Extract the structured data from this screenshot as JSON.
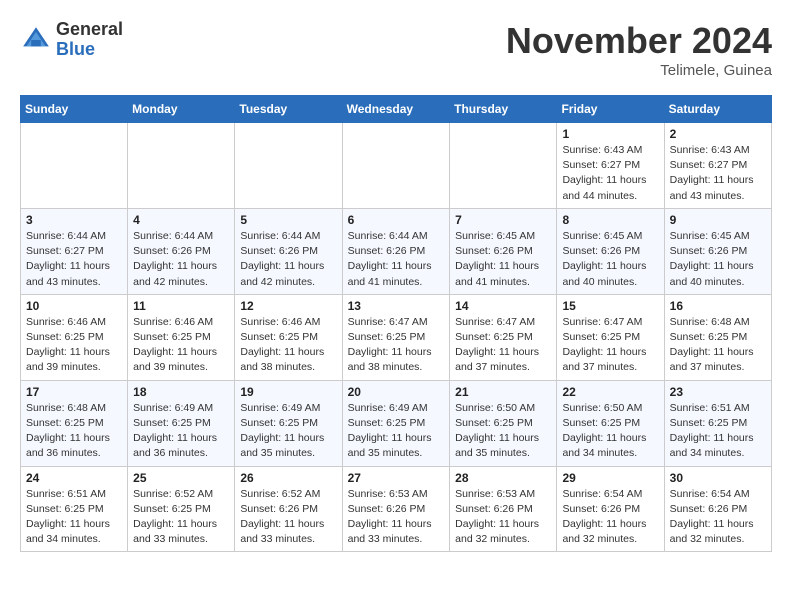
{
  "logo": {
    "text_general": "General",
    "text_blue": "Blue"
  },
  "title": "November 2024",
  "location": "Telimele, Guinea",
  "days_of_week": [
    "Sunday",
    "Monday",
    "Tuesday",
    "Wednesday",
    "Thursday",
    "Friday",
    "Saturday"
  ],
  "weeks": [
    [
      {
        "day": "",
        "info": ""
      },
      {
        "day": "",
        "info": ""
      },
      {
        "day": "",
        "info": ""
      },
      {
        "day": "",
        "info": ""
      },
      {
        "day": "",
        "info": ""
      },
      {
        "day": "1",
        "info": "Sunrise: 6:43 AM\nSunset: 6:27 PM\nDaylight: 11 hours and 44 minutes."
      },
      {
        "day": "2",
        "info": "Sunrise: 6:43 AM\nSunset: 6:27 PM\nDaylight: 11 hours and 43 minutes."
      }
    ],
    [
      {
        "day": "3",
        "info": "Sunrise: 6:44 AM\nSunset: 6:27 PM\nDaylight: 11 hours and 43 minutes."
      },
      {
        "day": "4",
        "info": "Sunrise: 6:44 AM\nSunset: 6:26 PM\nDaylight: 11 hours and 42 minutes."
      },
      {
        "day": "5",
        "info": "Sunrise: 6:44 AM\nSunset: 6:26 PM\nDaylight: 11 hours and 42 minutes."
      },
      {
        "day": "6",
        "info": "Sunrise: 6:44 AM\nSunset: 6:26 PM\nDaylight: 11 hours and 41 minutes."
      },
      {
        "day": "7",
        "info": "Sunrise: 6:45 AM\nSunset: 6:26 PM\nDaylight: 11 hours and 41 minutes."
      },
      {
        "day": "8",
        "info": "Sunrise: 6:45 AM\nSunset: 6:26 PM\nDaylight: 11 hours and 40 minutes."
      },
      {
        "day": "9",
        "info": "Sunrise: 6:45 AM\nSunset: 6:26 PM\nDaylight: 11 hours and 40 minutes."
      }
    ],
    [
      {
        "day": "10",
        "info": "Sunrise: 6:46 AM\nSunset: 6:25 PM\nDaylight: 11 hours and 39 minutes."
      },
      {
        "day": "11",
        "info": "Sunrise: 6:46 AM\nSunset: 6:25 PM\nDaylight: 11 hours and 39 minutes."
      },
      {
        "day": "12",
        "info": "Sunrise: 6:46 AM\nSunset: 6:25 PM\nDaylight: 11 hours and 38 minutes."
      },
      {
        "day": "13",
        "info": "Sunrise: 6:47 AM\nSunset: 6:25 PM\nDaylight: 11 hours and 38 minutes."
      },
      {
        "day": "14",
        "info": "Sunrise: 6:47 AM\nSunset: 6:25 PM\nDaylight: 11 hours and 37 minutes."
      },
      {
        "day": "15",
        "info": "Sunrise: 6:47 AM\nSunset: 6:25 PM\nDaylight: 11 hours and 37 minutes."
      },
      {
        "day": "16",
        "info": "Sunrise: 6:48 AM\nSunset: 6:25 PM\nDaylight: 11 hours and 37 minutes."
      }
    ],
    [
      {
        "day": "17",
        "info": "Sunrise: 6:48 AM\nSunset: 6:25 PM\nDaylight: 11 hours and 36 minutes."
      },
      {
        "day": "18",
        "info": "Sunrise: 6:49 AM\nSunset: 6:25 PM\nDaylight: 11 hours and 36 minutes."
      },
      {
        "day": "19",
        "info": "Sunrise: 6:49 AM\nSunset: 6:25 PM\nDaylight: 11 hours and 35 minutes."
      },
      {
        "day": "20",
        "info": "Sunrise: 6:49 AM\nSunset: 6:25 PM\nDaylight: 11 hours and 35 minutes."
      },
      {
        "day": "21",
        "info": "Sunrise: 6:50 AM\nSunset: 6:25 PM\nDaylight: 11 hours and 35 minutes."
      },
      {
        "day": "22",
        "info": "Sunrise: 6:50 AM\nSunset: 6:25 PM\nDaylight: 11 hours and 34 minutes."
      },
      {
        "day": "23",
        "info": "Sunrise: 6:51 AM\nSunset: 6:25 PM\nDaylight: 11 hours and 34 minutes."
      }
    ],
    [
      {
        "day": "24",
        "info": "Sunrise: 6:51 AM\nSunset: 6:25 PM\nDaylight: 11 hours and 34 minutes."
      },
      {
        "day": "25",
        "info": "Sunrise: 6:52 AM\nSunset: 6:25 PM\nDaylight: 11 hours and 33 minutes."
      },
      {
        "day": "26",
        "info": "Sunrise: 6:52 AM\nSunset: 6:26 PM\nDaylight: 11 hours and 33 minutes."
      },
      {
        "day": "27",
        "info": "Sunrise: 6:53 AM\nSunset: 6:26 PM\nDaylight: 11 hours and 33 minutes."
      },
      {
        "day": "28",
        "info": "Sunrise: 6:53 AM\nSunset: 6:26 PM\nDaylight: 11 hours and 32 minutes."
      },
      {
        "day": "29",
        "info": "Sunrise: 6:54 AM\nSunset: 6:26 PM\nDaylight: 11 hours and 32 minutes."
      },
      {
        "day": "30",
        "info": "Sunrise: 6:54 AM\nSunset: 6:26 PM\nDaylight: 11 hours and 32 minutes."
      }
    ]
  ]
}
